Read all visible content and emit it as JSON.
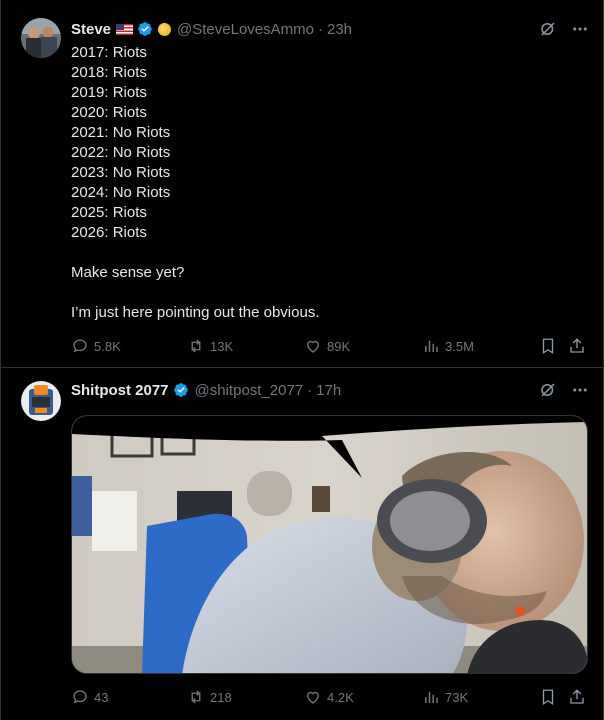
{
  "posts": [
    {
      "author_name": "Steve",
      "handle": "@SteveLovesAmmo",
      "separator": "·",
      "time": "23h",
      "lines": [
        "2017: Riots",
        "2018: Riots",
        "2019: Riots",
        "2020: Riots",
        "2021: No Riots",
        "2022: No Riots",
        "2023: No Riots",
        "2024: No Riots",
        "2025: Riots",
        "2026: Riots"
      ],
      "para2": "Make sense yet?",
      "para3": "I’m just here pointing out the obvious.",
      "stats": {
        "replies": "5.8K",
        "reposts": "13K",
        "likes": "89K",
        "views": "3.5M"
      }
    },
    {
      "author_name": "Shitpost 2077",
      "handle": "@shitpost_2077",
      "separator": "·",
      "time": "17h",
      "media_kind": "video",
      "stats": {
        "replies": "43",
        "reposts": "218",
        "likes": "4.2K",
        "views": "73K"
      }
    }
  ],
  "colors": {
    "background": "#000000",
    "text": "#e7e9ea",
    "muted": "#71767b",
    "verified": "#1d9bf0",
    "divider": "#2f3336"
  },
  "icons": [
    "verified-badge-icon",
    "us-flag-icon",
    "coin-icon",
    "grok-icon",
    "more-icon",
    "reply-icon",
    "repost-icon",
    "like-icon",
    "views-icon",
    "bookmark-icon",
    "share-icon"
  ]
}
